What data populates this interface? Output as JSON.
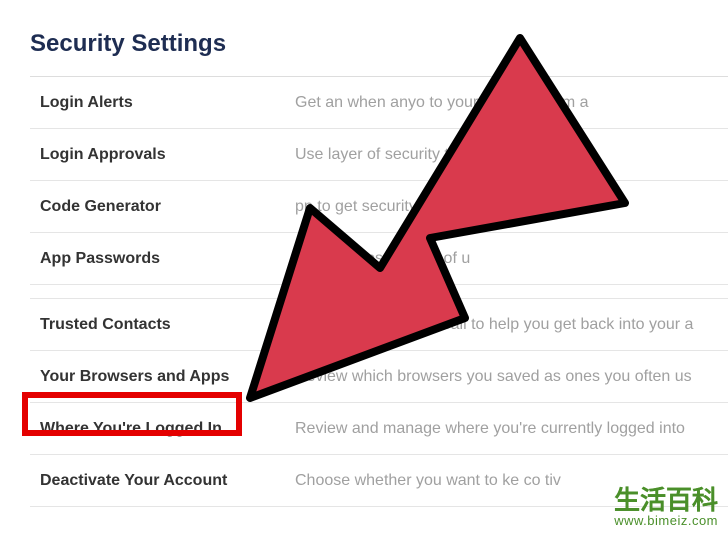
{
  "page": {
    "title": "Security Settings"
  },
  "settings": [
    {
      "label": "Login Alerts",
      "desc": "Get an        when anyo             to your account from a "
    },
    {
      "label": "Login Approvals",
      "desc": "Use                                  layer of security to keep oth"
    },
    {
      "label": "Code Generator",
      "desc": "                                  pp to get security codes when you"
    },
    {
      "label": "App Passwords",
      "desc": "                                          to your apps instead of u"
    },
    {
      "label": "Trusted Contacts",
      "desc": "Pick friends you can call to help you get back into your a"
    },
    {
      "label": "Your Browsers and Apps",
      "desc": "Review which browsers you saved as ones you often us"
    },
    {
      "label": "Where You're Logged In",
      "desc": "Review and manage where you're currently logged into"
    },
    {
      "label": "Deactivate Your Account",
      "desc": "Choose whether you want to ke               co            tiv"
    }
  ],
  "watermark": {
    "cn": "生活百科",
    "url": "www.bimeiz.com"
  },
  "overlay": {
    "arrow_color": "#d93a4d",
    "highlight_color": "#e40000"
  }
}
